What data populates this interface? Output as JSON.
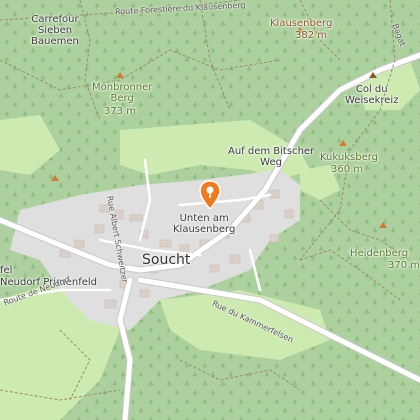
{
  "map": {
    "labels": {
      "carrefour": "Carrefour\nSieben\nBauemen",
      "klausenberg_name": "Klausenberg",
      "klausenberg_elev": "382 m",
      "route_forestiere": "Route Forestière du Klausenberg",
      "monbronner_name": "Monbronner\nBerg",
      "monbronner_elev": "373 m",
      "col_du_weisekreiz": "Col du\nWeisekreiz",
      "bitscher_weg": "Auf dem Bitscher\nWeg",
      "kukuksberg_name": "Kukuksberg",
      "kukuksberg_elev": "360 m",
      "rue_albert": "Rue Albert Schweitzer",
      "unten_am_klausenberg": "Unten am\nKlausenberg",
      "soucht": "Soucht",
      "heidenberg_name": "Heidenberg",
      "heidenberg_elev": "370 m",
      "rue_kammerfelsen": "Rue du Kammerfelsen",
      "neudorf_primenfeld": "Neudorf Primenfeld",
      "fel": "fel",
      "bagatelle": "Bagat",
      "route_neudorf": "Route de Neudorf"
    },
    "colors": {
      "forest": "#add19e",
      "grass": "#cdebb0",
      "residential": "#e0dfdf",
      "building": "#d9d0c9",
      "road_main": "#ffffff",
      "marker": "#f07a1f",
      "peak": "#d07a3a"
    },
    "icons": {
      "marker": "map-pin-icon",
      "peak": "peak-triangle-icon"
    }
  }
}
